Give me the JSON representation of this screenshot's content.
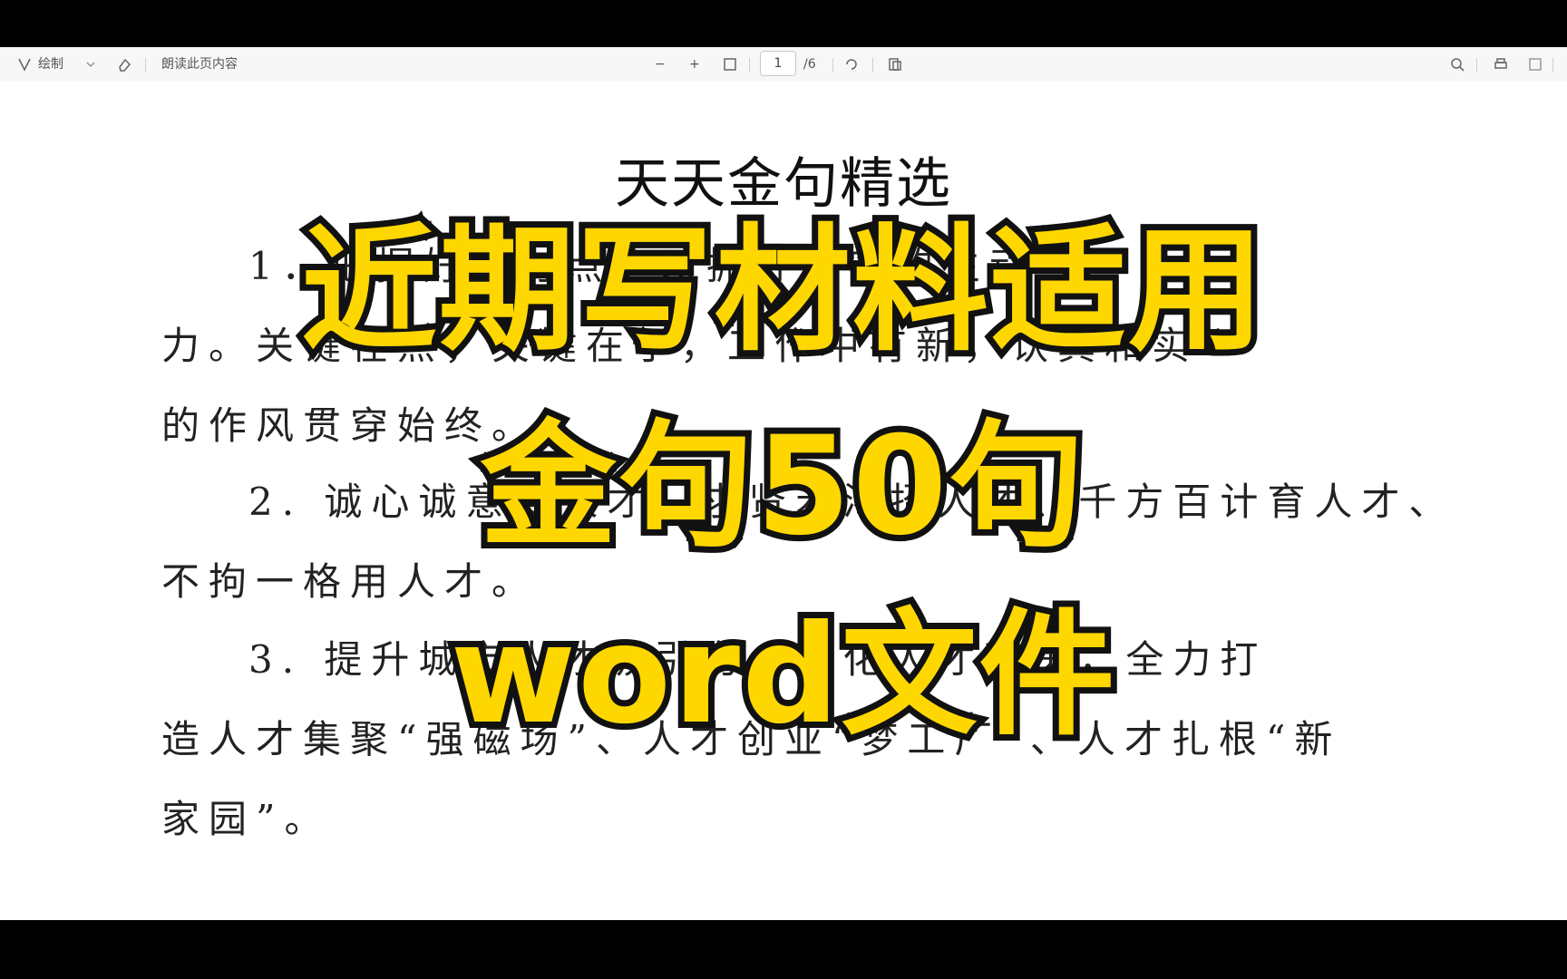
{
  "toolbar": {
    "draw_label": "绘制",
    "read_label": "朗读此页内容",
    "zoom_out": "−",
    "zoom_in": "+",
    "page_current": "1",
    "page_total": "/6"
  },
  "document": {
    "title": "天天金句精选",
    "paragraphs": [
      {
        "lines": [
          "1．把握好着力点，以抓好落实的生动",
          "力。关键在点，关键在于，工作中有新，认真和实",
          "的作风贯穿始终。"
        ]
      },
      {
        "lines": [
          "2. 诚心诚意爱人才、求贤若渴招人才、千方百计育人才、",
          "不拘一格用人才。"
        ]
      },
      {
        "lines": [
          "3. 提升城市人才吸引力，深化人才政策，全力打",
          "造人才集聚“强磁场”、人才创业“梦工厂”、人才扎根“新",
          "家园”。"
        ]
      }
    ]
  },
  "overlay": {
    "line1": "近期写材料适用",
    "line2": "金句50句",
    "line3": "word文件",
    "fill_color": "#FFD700",
    "stroke_color": "#111111"
  }
}
